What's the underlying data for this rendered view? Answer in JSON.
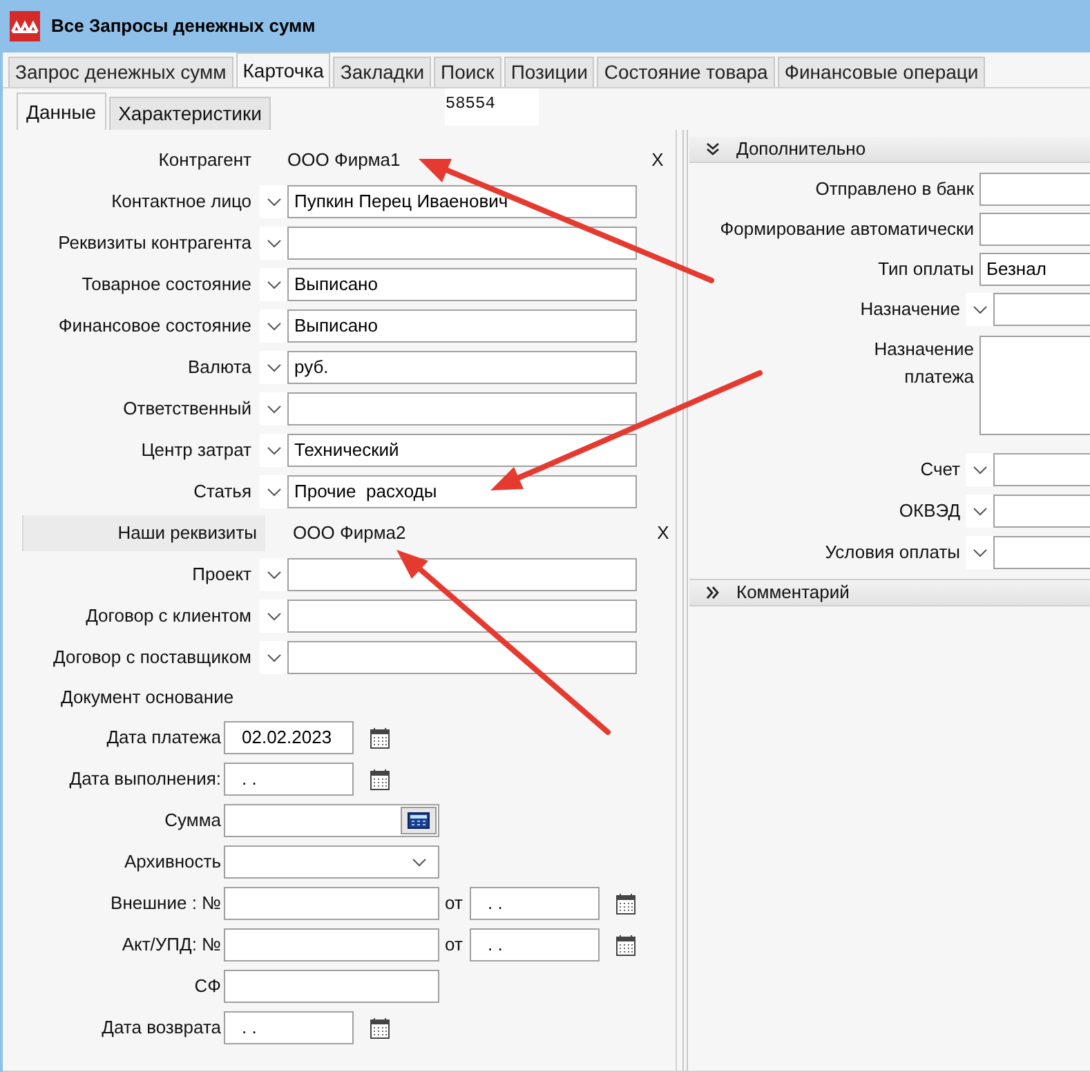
{
  "window": {
    "title": "Все Запросы денежных сумм"
  },
  "tabs": [
    {
      "label": "Запрос денежных сумм",
      "selected": false
    },
    {
      "label": "Карточка",
      "selected": true
    },
    {
      "label": "Закладки",
      "selected": false
    },
    {
      "label": "Поиск",
      "selected": false
    },
    {
      "label": "Позиции",
      "selected": false
    },
    {
      "label": "Состояние товара",
      "selected": false
    },
    {
      "label": "Финансовые операци",
      "selected": false
    }
  ],
  "subtabs": [
    {
      "label": "Данные",
      "selected": true
    },
    {
      "label": "Характеристики",
      "selected": false
    }
  ],
  "record_number": "58554",
  "main_fields": [
    {
      "kind": "display",
      "label": "Контрагент",
      "value": "ООО Фирма1",
      "clear": "X"
    },
    {
      "kind": "dropdown",
      "label": "Контактное лицо",
      "value": "Пупкин Перец Иваенович"
    },
    {
      "kind": "dropdown",
      "label": "Реквизиты контрагента"
    },
    {
      "kind": "dropdown",
      "label": "Товарное состояние",
      "value": "Выписано"
    },
    {
      "kind": "dropdown",
      "label": "Финансовое состояние",
      "value": "Выписано"
    },
    {
      "kind": "dropdown",
      "label": "Валюта",
      "value": "руб."
    },
    {
      "kind": "dropdown",
      "label": "Ответственный"
    },
    {
      "kind": "dropdown",
      "label": "Центр затрат",
      "value": "Технический"
    },
    {
      "kind": "dropdown",
      "label": "Статья",
      "value": "Прочие  расходы"
    },
    {
      "kind": "button_display",
      "label": "Наши реквизиты",
      "value": "ООО Фирма2",
      "clear": "X"
    },
    {
      "kind": "dropdown",
      "label": "Проект"
    },
    {
      "kind": "dropdown",
      "label": "Договор с клиентом"
    },
    {
      "kind": "dropdown",
      "label": "Договор с поставщиком"
    }
  ],
  "document_basis": {
    "title": "Документ основание"
  },
  "doc_fields": [
    {
      "kind": "date",
      "label": "Дата платежа",
      "value": "02.02.2023"
    },
    {
      "kind": "date",
      "label": "Дата выполнения:",
      "value": ". ."
    },
    {
      "kind": "calc",
      "label": "Сумма"
    },
    {
      "kind": "select",
      "label": "Архивность"
    },
    {
      "kind": "number_date",
      "label": "Внешние : №",
      "from_label": "от",
      "date": ". ."
    },
    {
      "kind": "number_date",
      "label": "Акт/УПД: №",
      "from_label": "от",
      "date": ". ."
    },
    {
      "kind": "text",
      "label": "СФ"
    },
    {
      "kind": "date",
      "label": "Дата возврата",
      "value": ". ."
    }
  ],
  "additional": {
    "title": "Дополнительно",
    "expanded": true,
    "fields": [
      {
        "kind": "text",
        "label": "Отправлено в банк"
      },
      {
        "kind": "text",
        "label": "Формирование автоматически"
      },
      {
        "kind": "text",
        "label": "Тип оплаты",
        "value": "Безнал"
      },
      {
        "kind": "combo",
        "label": "Назначение"
      },
      {
        "kind": "textarea",
        "label": "Назначение платежа"
      },
      {
        "kind": "combo",
        "label": "Счет"
      },
      {
        "kind": "combo",
        "label": "ОКВЭД"
      },
      {
        "kind": "combo",
        "label": "Условия оплаты"
      }
    ]
  },
  "comment": {
    "title": "Комментарий",
    "expanded": false
  }
}
